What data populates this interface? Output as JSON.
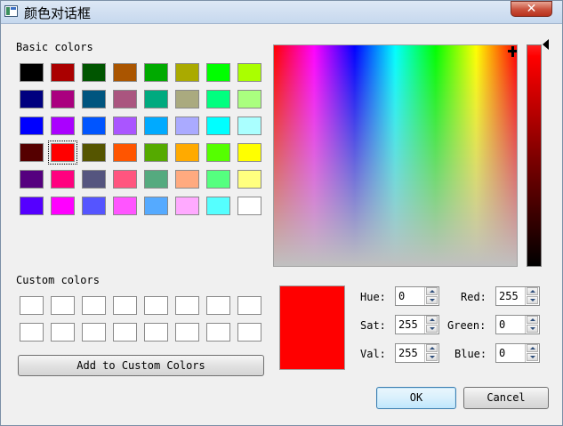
{
  "window": {
    "title": "颜色对话框",
    "close_glyph": "✕"
  },
  "basic_colors": {
    "label": "Basic colors",
    "selected_index": 25,
    "swatches": [
      "#000000",
      "#aa0000",
      "#005500",
      "#aa5500",
      "#00aa00",
      "#aaaa00",
      "#00ff00",
      "#aaff00",
      "#00007f",
      "#aa007f",
      "#00557f",
      "#aa557f",
      "#00aa7f",
      "#aaaa7f",
      "#00ff7f",
      "#aaff7f",
      "#0000ff",
      "#aa00ff",
      "#0055ff",
      "#aa55ff",
      "#00aaff",
      "#aaaaff",
      "#00ffff",
      "#aaffff",
      "#550000",
      "#ff0000",
      "#555500",
      "#ff5500",
      "#55aa00",
      "#ffaa00",
      "#55ff00",
      "#ffff00",
      "#55007f",
      "#ff007f",
      "#55557f",
      "#ff557f",
      "#55aa7f",
      "#ffaa7f",
      "#55ff7f",
      "#ffff7f",
      "#5500ff",
      "#ff00ff",
      "#5555ff",
      "#ff55ff",
      "#55aaff",
      "#ffaaff",
      "#55ffff",
      "#ffffff"
    ]
  },
  "custom_colors": {
    "label": "Custom colors",
    "swatches": [
      "#ffffff",
      "#ffffff",
      "#ffffff",
      "#ffffff",
      "#ffffff",
      "#ffffff",
      "#ffffff",
      "#ffffff",
      "#ffffff",
      "#ffffff",
      "#ffffff",
      "#ffffff",
      "#ffffff",
      "#ffffff",
      "#ffffff",
      "#ffffff"
    ],
    "add_button": "Add to Custom Colors"
  },
  "current_color": "#ff0000",
  "fields": {
    "hue": {
      "label": "Hue:",
      "value": "0"
    },
    "sat": {
      "label": "Sat:",
      "value": "255"
    },
    "val": {
      "label": "Val:",
      "value": "255"
    },
    "red": {
      "label": "Red:",
      "value": "255"
    },
    "green": {
      "label": "Green:",
      "value": "0"
    },
    "blue": {
      "label": "Blue:",
      "value": "0"
    }
  },
  "buttons": {
    "ok": "OK",
    "cancel": "Cancel"
  }
}
